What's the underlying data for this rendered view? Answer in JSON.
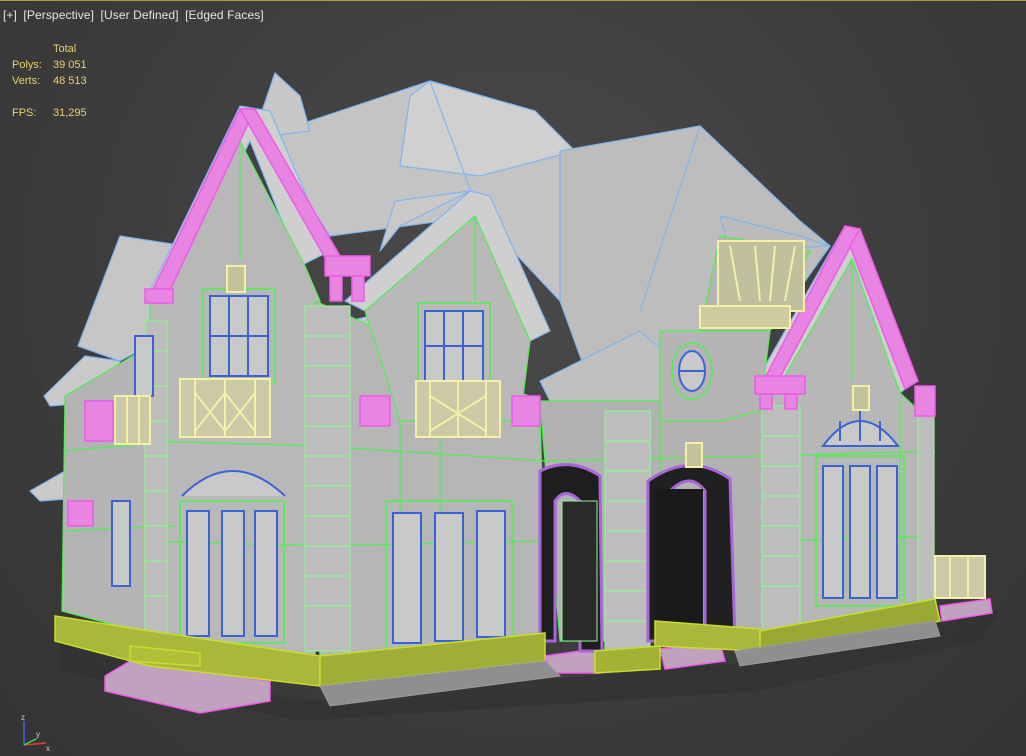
{
  "viewport": {
    "labels": [
      "[+]",
      "[Perspective]",
      "[User Defined]",
      "[Edged Faces]"
    ]
  },
  "stats": {
    "header": "Total",
    "polys_label": "Polys:",
    "polys_value": "39 051",
    "verts_label": "Verts:",
    "verts_value": "48 513",
    "fps_label": "FPS:",
    "fps_value": "31,295"
  },
  "gizmo": {
    "x": "x",
    "y": "y",
    "z": "z"
  },
  "colors": {
    "background": "#3f3f3f",
    "stats_text": "#e7d06a",
    "wall_fill": "#b9b9b9",
    "roof_fill": "#c2c2c2",
    "wire_green": "#4ef04e",
    "wire_magenta": "#ef5ae8",
    "wire_blue": "#7fb5f0",
    "wire_cream": "#f4f0a8",
    "window_blue": "#2f4fb4"
  }
}
